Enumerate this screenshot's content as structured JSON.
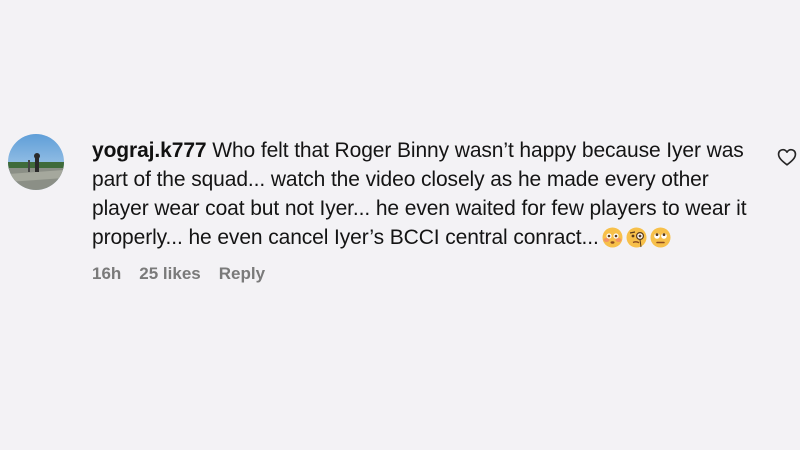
{
  "comment": {
    "username": "yograj.k777",
    "text": "Who felt that Roger Binny wasn’t happy because Iyer was part of the squad... watch the video closely as he made every other player wear coat but not Iyer... he even waited for few players to wear it properly... he even cancel Iyer’s BCCI central conract...",
    "emojis": [
      "flushed-face-emoji",
      "face-with-monocle-emoji",
      "face-with-rolling-eyes-emoji"
    ],
    "time": "16h",
    "likes": "25 likes",
    "reply_label": "Reply",
    "like_icon": "heart-outline-icon"
  },
  "colors": {
    "background": "#f3f2f5",
    "text": "#141414",
    "meta": "#7a7a7a"
  }
}
